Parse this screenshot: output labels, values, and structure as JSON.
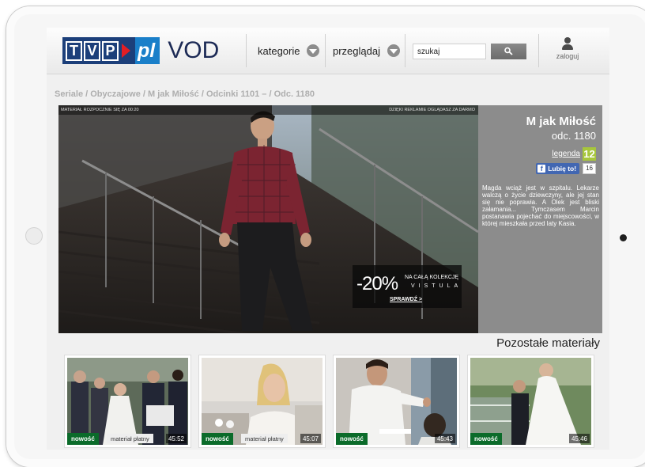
{
  "logo": {
    "letters": [
      "T",
      "V",
      "P"
    ],
    "pl": "pl",
    "vod": "VOD"
  },
  "nav": {
    "categories_label": "kategorie",
    "browse_label": "przeglądaj"
  },
  "search": {
    "value": "szukaj",
    "button_icon": "search-icon"
  },
  "account": {
    "login_label": "zaloguj",
    "icon": "user-icon"
  },
  "breadcrumb": "Seriale / Obyczajowe / M jak Miłość / Odcinki 1101 – / Odc. 1180",
  "player": {
    "overlay_left": "MATERIAŁ ROZPOCZNIE SIĘ ZA 00:20",
    "overlay_right": "DZIĘKI REKLAMIE OGLĄDASZ ZA DARMO",
    "ad": {
      "discount": "-20%",
      "line1": "NA CAŁĄ KOLEKCJĘ",
      "brand": "VISTULA",
      "cta": "SPRAWDŹ >"
    }
  },
  "episode": {
    "title": "M jak Miłość",
    "number": "odc. 1180",
    "legend_label": "legenda",
    "age_rating": "12",
    "like_label": "Lubię to!",
    "like_count": "16",
    "description": "Magda wciąż jest w szpitalu. Lekarze walczą o życie dziewczyny, ale jej stan się nie poprawia. A Olek jest bliski załamania... Tymczasem Marcin postanawia pojechać do miejscowości, w której mieszkała przed laty Kasia."
  },
  "more": {
    "title": "Pozostałe materiały",
    "items": [
      {
        "badge": "nowość",
        "paid": "materiał płatny",
        "duration": "45:52"
      },
      {
        "badge": "nowość",
        "paid": "materiał płatny",
        "duration": "45:07"
      },
      {
        "badge": "nowość",
        "paid": "",
        "duration": "45:43"
      },
      {
        "badge": "nowość",
        "paid": "",
        "duration": "45:46"
      }
    ]
  },
  "colors": {
    "brand_navy": "#1c3f7a",
    "brand_blue": "#1a7fc9",
    "play_red": "#e31e24",
    "new_green": "#0b6b2a",
    "age_green": "#a7c63c",
    "facebook": "#4267b2"
  }
}
